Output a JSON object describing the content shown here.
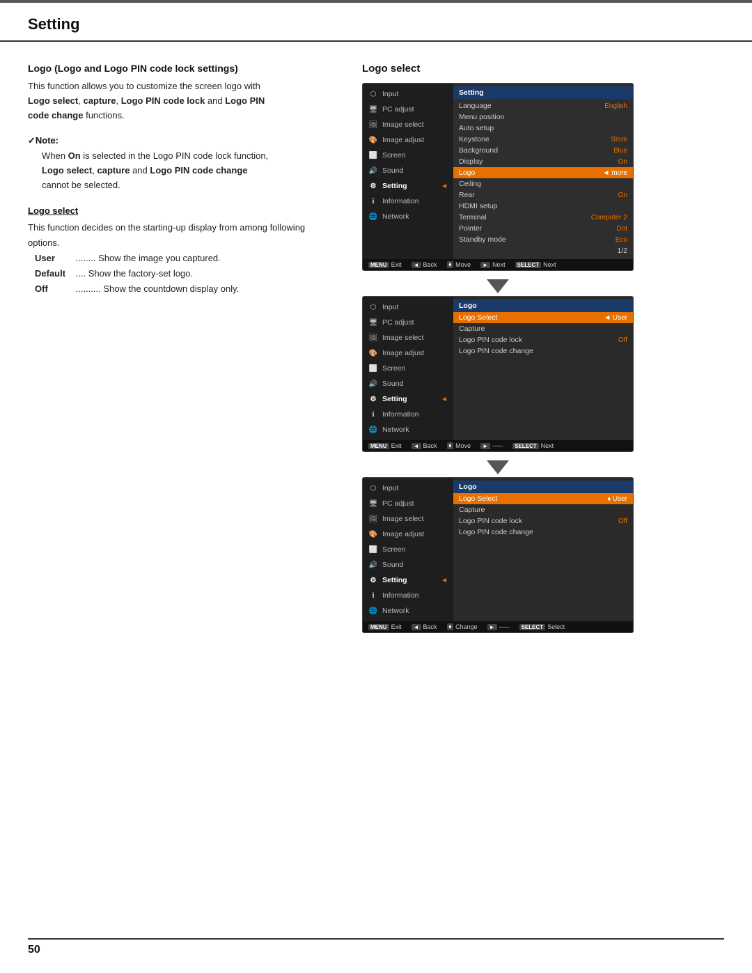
{
  "page": {
    "title": "Setting",
    "page_number": "50"
  },
  "left": {
    "main_heading": "Logo (Logo and Logo PIN code lock settings)",
    "main_body_1": "This function allows you to customize the screen logo with",
    "main_body_bold_1": "Logo select",
    "main_body_2": ", ",
    "main_body_bold_2": "capture",
    "main_body_3": ", ",
    "main_body_bold_3": "Logo PIN code lock",
    "main_body_4": " and ",
    "main_body_bold_4": "Logo PIN",
    "main_body_5": "code change",
    "main_body_6": " functions.",
    "note_label": "✓Note:",
    "note_text_1": "When ",
    "note_bold_1": "On",
    "note_text_2": " is selected in the Logo PIN code lock function,",
    "note_bold_2": "Logo select",
    "note_text_3": ", ",
    "note_bold_3": "capture",
    "note_text_4": " and ",
    "note_bold_4": "Logo PIN code change",
    "note_text_5": "cannot be selected.",
    "subsection_heading": "Logo select",
    "subsection_body": "This function decides on the starting-up display from among following options.",
    "options": [
      {
        "key": "User",
        "dots": "........",
        "desc": "Show the image you captured."
      },
      {
        "key": "Default",
        "dots": "....",
        "desc": "Show the factory-set logo."
      },
      {
        "key": "Off",
        "dots": "..........",
        "desc": "Show the countdown display only."
      }
    ]
  },
  "right": {
    "logo_select_title": "Logo select",
    "panel1": {
      "menu_items": [
        {
          "icon": "input-icon",
          "label": "Input",
          "active": false
        },
        {
          "icon": "pc-icon",
          "label": "PC adjust",
          "active": false
        },
        {
          "icon": "image-select-icon",
          "label": "Image select",
          "active": false
        },
        {
          "icon": "image-adjust-icon",
          "label": "Image adjust",
          "active": false
        },
        {
          "icon": "screen-icon",
          "label": "Screen",
          "active": false
        },
        {
          "icon": "sound-icon",
          "label": "Sound",
          "active": false
        },
        {
          "icon": "setting-icon",
          "label": "Setting",
          "active": true,
          "arrow": true
        },
        {
          "icon": "info-icon",
          "label": "Information",
          "active": false
        },
        {
          "icon": "network-icon",
          "label": "Network",
          "active": false
        }
      ],
      "right_header": "Setting",
      "right_items": [
        {
          "label": "Language",
          "value": "English",
          "highlighted": false
        },
        {
          "label": "Menu position",
          "value": "",
          "highlighted": false
        },
        {
          "label": "Auto setup",
          "value": "",
          "highlighted": false
        },
        {
          "label": "Keystone",
          "value": "Store",
          "highlighted": false
        },
        {
          "label": "Background",
          "value": "Blue",
          "highlighted": false
        },
        {
          "label": "Display",
          "value": "On",
          "highlighted": false
        },
        {
          "label": "Logo",
          "value": "◄ more",
          "highlighted": true
        },
        {
          "label": "Ceiling",
          "value": "",
          "highlighted": false
        },
        {
          "label": "Rear",
          "value": "On",
          "highlighted": false
        },
        {
          "label": "HDMI setup",
          "value": "",
          "highlighted": false
        },
        {
          "label": "Terminal",
          "value": "Computer 2",
          "highlighted": false
        },
        {
          "label": "Pointer",
          "value": "Dot",
          "highlighted": false
        },
        {
          "label": "Standby mode",
          "value": "Eco",
          "highlighted": false
        },
        {
          "label": "1/2",
          "value": "",
          "highlighted": false,
          "right_align": true
        }
      ],
      "bar": [
        {
          "key": "MENU",
          "action": "Exit"
        },
        {
          "key": "◄",
          "action": "Back"
        },
        {
          "key": "⬧",
          "action": "Move"
        },
        {
          "key": "►",
          "action": "Next"
        },
        {
          "key": "SELECT",
          "action": "Next"
        }
      ]
    },
    "panel2": {
      "menu_items": [
        {
          "icon": "input-icon",
          "label": "Input",
          "active": false
        },
        {
          "icon": "pc-icon",
          "label": "PC adjust",
          "active": false
        },
        {
          "icon": "image-select-icon",
          "label": "Image select",
          "active": false
        },
        {
          "icon": "image-adjust-icon",
          "label": "Image adjust",
          "active": false
        },
        {
          "icon": "screen-icon",
          "label": "Screen",
          "active": false
        },
        {
          "icon": "sound-icon",
          "label": "Sound",
          "active": false
        },
        {
          "icon": "setting-icon",
          "label": "Setting",
          "active": true,
          "arrow": true
        },
        {
          "icon": "info-icon",
          "label": "Information",
          "active": false
        },
        {
          "icon": "network-icon",
          "label": "Network",
          "active": false
        }
      ],
      "sub_header": "Logo",
      "sub_items": [
        {
          "label": "Logo Select",
          "value": "◄ User",
          "highlighted": true
        },
        {
          "label": "Capture",
          "value": "",
          "highlighted": false
        },
        {
          "label": "Logo PIN code lock",
          "value": "Off",
          "highlighted": false
        },
        {
          "label": "Logo PIN code change",
          "value": "",
          "highlighted": false
        }
      ],
      "bar": [
        {
          "key": "MENU",
          "action": "Exit"
        },
        {
          "key": "◄",
          "action": "Back"
        },
        {
          "key": "⬧",
          "action": "Move"
        },
        {
          "key": "►",
          "action": "-----"
        },
        {
          "key": "SELECT",
          "action": "Next"
        }
      ]
    },
    "panel3": {
      "menu_items": [
        {
          "icon": "input-icon",
          "label": "Input",
          "active": false
        },
        {
          "icon": "pc-icon",
          "label": "PC adjust",
          "active": false
        },
        {
          "icon": "image-select-icon",
          "label": "Image select",
          "active": false
        },
        {
          "icon": "image-adjust-icon",
          "label": "Image adjust",
          "active": false
        },
        {
          "icon": "screen-icon",
          "label": "Screen",
          "active": false
        },
        {
          "icon": "sound-icon",
          "label": "Sound",
          "active": false
        },
        {
          "icon": "setting-icon",
          "label": "Setting",
          "active": true,
          "arrow": true
        },
        {
          "icon": "info-icon",
          "label": "Information",
          "active": false
        },
        {
          "icon": "network-icon",
          "label": "Network",
          "active": false
        }
      ],
      "sub_header": "Logo",
      "sub_items": [
        {
          "label": "Logo Select",
          "value": "⬧ User",
          "highlighted": true
        },
        {
          "label": "Capture",
          "value": "",
          "highlighted": false
        },
        {
          "label": "Logo PIN code lock",
          "value": "Off",
          "highlighted": false
        },
        {
          "label": "Logo PIN code change",
          "value": "",
          "highlighted": false
        }
      ],
      "bar": [
        {
          "key": "MENU",
          "action": "Exit"
        },
        {
          "key": "◄",
          "action": "Back"
        },
        {
          "key": "⬧",
          "action": "Change"
        },
        {
          "key": "►",
          "action": "-----"
        },
        {
          "key": "SELECT",
          "action": "Select"
        }
      ]
    }
  }
}
